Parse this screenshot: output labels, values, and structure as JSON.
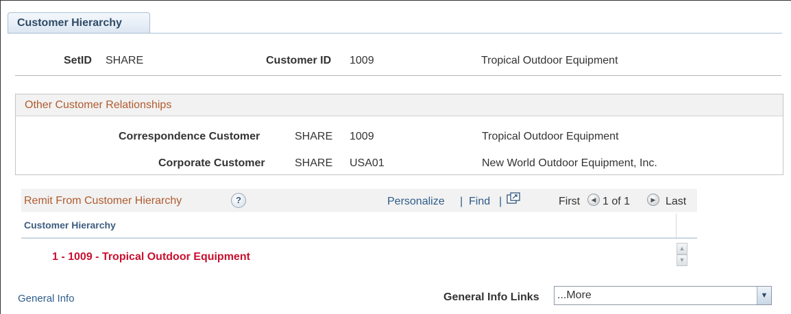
{
  "tab": {
    "label": "Customer Hierarchy"
  },
  "header": {
    "setid_label": "SetID",
    "setid_value": "SHARE",
    "customer_id_label": "Customer ID",
    "customer_id_value": "1009",
    "customer_name": "Tropical Outdoor Equipment"
  },
  "relationships": {
    "title": "Other Customer Relationships",
    "rows": [
      {
        "label": "Correspondence Customer",
        "setid": "SHARE",
        "id": "1009",
        "name": "Tropical Outdoor Equipment"
      },
      {
        "label": "Corporate Customer",
        "setid": "SHARE",
        "id": "USA01",
        "name": "New World Outdoor Equipment, Inc."
      }
    ]
  },
  "grid": {
    "title": "Remit From Customer Hierarchy",
    "help_glyph": "?",
    "personalize": "Personalize",
    "separator": "|",
    "find": "Find",
    "first": "First",
    "range": "1 of 1",
    "last": "Last",
    "column_header": "Customer Hierarchy",
    "tree_item": "1 - 1009 - Tropical Outdoor Equipment",
    "icons": [
      "help-icon",
      "popout-icon",
      "previous-icon",
      "next-icon",
      "scroll-up-icon",
      "scroll-down-icon"
    ]
  },
  "footer": {
    "link": "General Info",
    "links_label": "General Info Links",
    "select_value": "...More"
  },
  "colors": {
    "link": "#2d5c8a",
    "section_title": "#b05a2e",
    "tree_item": "#c8102e",
    "tab_border": "#a9bfd6"
  }
}
